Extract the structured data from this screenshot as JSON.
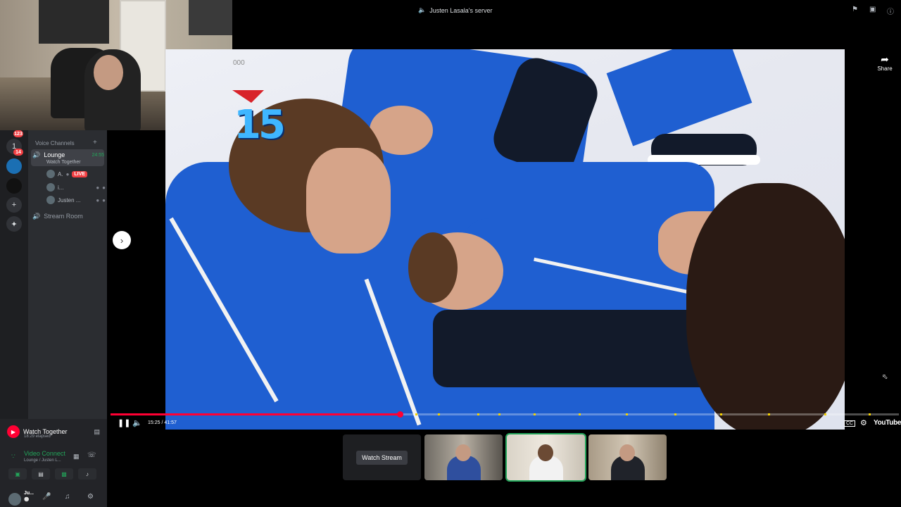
{
  "topbar": {
    "server_title": "Justen Lasala's server",
    "icons": [
      "flag-icon",
      "screen-icon",
      "help-icon"
    ]
  },
  "sidebar": {
    "badges": [
      "123",
      "14"
    ],
    "section_header": "Voice Channels",
    "channels": [
      {
        "name": "Lounge",
        "time": "24:55",
        "activity": "Watch Together"
      },
      {
        "name": "Stream Room"
      }
    ],
    "members": [
      {
        "name": "A.",
        "live": "LIVE"
      },
      {
        "name": "i..."
      },
      {
        "name": "Justen ..."
      }
    ]
  },
  "video": {
    "score_prefix": "000",
    "score_number": "15",
    "share_label": "Share"
  },
  "player": {
    "current_time": "15:25",
    "duration": "41:57",
    "timecode": "15:25 / 41:57",
    "progress": 0.367,
    "cc_label": "CC",
    "brand": "YouTube",
    "chapters": [
      0.387,
      0.415,
      0.465,
      0.492,
      0.537,
      0.594,
      0.654,
      0.715,
      0.773,
      0.834,
      0.905,
      0.962
    ]
  },
  "streams": {
    "watch_stream_label": "Watch Stream"
  },
  "user_panel": {
    "activity_title": "Watch Together",
    "activity_elapsed": "18:29 elapsed",
    "voice_title": "Video Connect",
    "voice_sub": "Lounge / Justen L...",
    "username": "Ju...",
    "user_status": "⚪"
  },
  "colors": {
    "live_red": "#f23f43",
    "connected_green": "#23a55a",
    "youtube_red": "#ff0033",
    "jersey_blue": "#1f5fd1"
  }
}
